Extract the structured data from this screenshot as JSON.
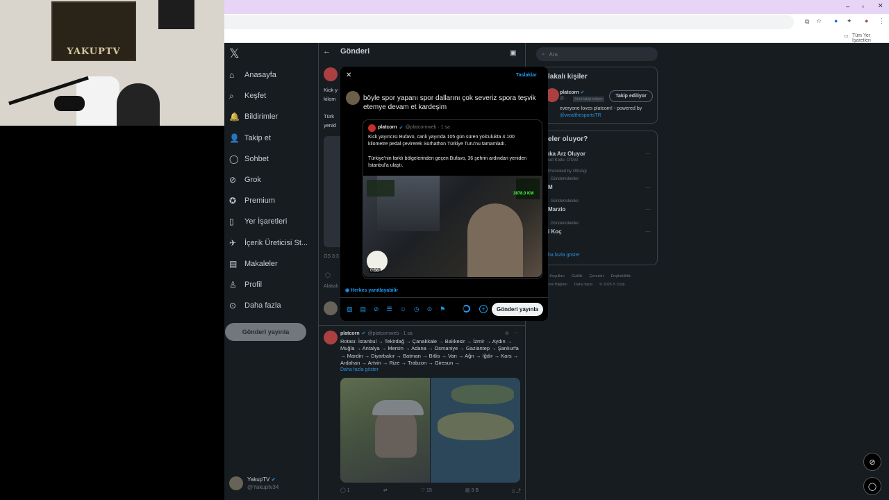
{
  "browser": {
    "bookmarks_label": "Tüm Yer İşaretleri"
  },
  "webcam": {
    "poster_text": "YAKUPTV"
  },
  "sidebar": {
    "items": [
      {
        "label": "Anasayfa",
        "icon": "home-icon"
      },
      {
        "label": "Keşfet",
        "icon": "search-icon"
      },
      {
        "label": "Bildirimler",
        "icon": "bell-icon"
      },
      {
        "label": "Takip et",
        "icon": "person-plus-icon"
      },
      {
        "label": "Sohbet",
        "icon": "chat-icon"
      },
      {
        "label": "Grok",
        "icon": "grok-icon"
      },
      {
        "label": "Premium",
        "icon": "premium-icon"
      },
      {
        "label": "Yer İşaretleri",
        "icon": "bookmark-icon"
      },
      {
        "label": "İçerik Üreticisi St...",
        "icon": "rocket-icon"
      },
      {
        "label": "Makaleler",
        "icon": "article-icon"
      },
      {
        "label": "Profil",
        "icon": "profile-icon"
      },
      {
        "label": "Daha fazla",
        "icon": "more-icon"
      }
    ],
    "post_button": "Gönderi yayınla",
    "account": {
      "name": "YakupTV",
      "handle": "@Yakuptv34"
    }
  },
  "main": {
    "title": "Gönderi",
    "bg_tweet_snippet": [
      "Kick y",
      "kilom",
      "Türk",
      "yenid"
    ],
    "time_snippet": "ÖS 3:3",
    "like_snippet": "Alakalı",
    "tweet2": {
      "name": "platcorn",
      "handle": "@platcornweb · 1 sa",
      "text": "Rotası: İstanbul → Tekirdağ → Çanakkale → Balıkesir → İzmir → Aydın → Muğla → Antalya → Mersin → Adana → Osmaniye → Gaziantep → Şanlıurfa → Mardin → Diyarbakır → Batman → Bitlis → Van → Ağrı → Iğdır → Kars → Ardahan → Artvin → Rize → Trabzon → Giresun →",
      "show_more": "Daha fazla göster",
      "stats": {
        "replies": "1",
        "retweets": "",
        "likes": "15",
        "views": "3 B"
      }
    }
  },
  "right": {
    "search_placeholder": "Ara",
    "who_title": "lakalı kişiler",
    "suggest": {
      "name": "platcorn",
      "handle": "@...",
      "badge": "Seni takip ediyor",
      "follow_label": "Takip ediliyor",
      "bio": "everyone loves platcorn! - powered by",
      "bio_link": "@wealthesportsTR"
    },
    "trends_title": "eler oluyor?",
    "trends": [
      {
        "meta": "",
        "name": "ıka Arz Oluyor",
        "sub": "set Kodu: OTAG"
      },
      {
        "meta": "· Gündemdekiler",
        "name": "M",
        "sub": ""
      },
      {
        "meta": "· Gündemdekiler",
        "name": "Marzio",
        "sub": ""
      },
      {
        "meta": "· Gündemdekiler",
        "name": "i Koç",
        "sub": ""
      }
    ],
    "promoted": "Promoted by OttoAgi",
    "show_more": "ha fazla göster",
    "footer": [
      "· Koşulları",
      "Gizlilik",
      "Çerezler",
      "Erişilebilirlik",
      "rem Bilgileri",
      "Daha fazla",
      "© 2025 X Corp."
    ]
  },
  "modal": {
    "close_icon": "close-icon",
    "drafts_label": "Taslaklar",
    "compose_text": "böyle spor yapanı spor dallarını çok severiz spora teşvik etemye devam et kardeşim",
    "quote": {
      "name": "platcorn",
      "handle": "@platcornweb · 1 sa",
      "text1": "Kick yayıncısı Bufavo, canlı yayında 105 gün süren yolculukta 4.100 kilometre pedal çevirerek Sürhathon Türkiye Turu'nu tamamladı.",
      "text2": "Türkiye'nin farklı bölgelerinden geçen Bufavo, 36 şehrin ardından yeniden İstanbul'a ulaştı.",
      "video_duration": "0:56",
      "overlay_speed": "3878.0 KM"
    },
    "reply_setting": "Herkes yanıtlayabilir",
    "reply_button": "Gönderi yayınla"
  },
  "colors": {
    "accent": "#1d9bf0",
    "background": "#000000",
    "text": "#e7e9ea",
    "muted": "#71767b",
    "chrome_top": "#e8d4f4"
  }
}
